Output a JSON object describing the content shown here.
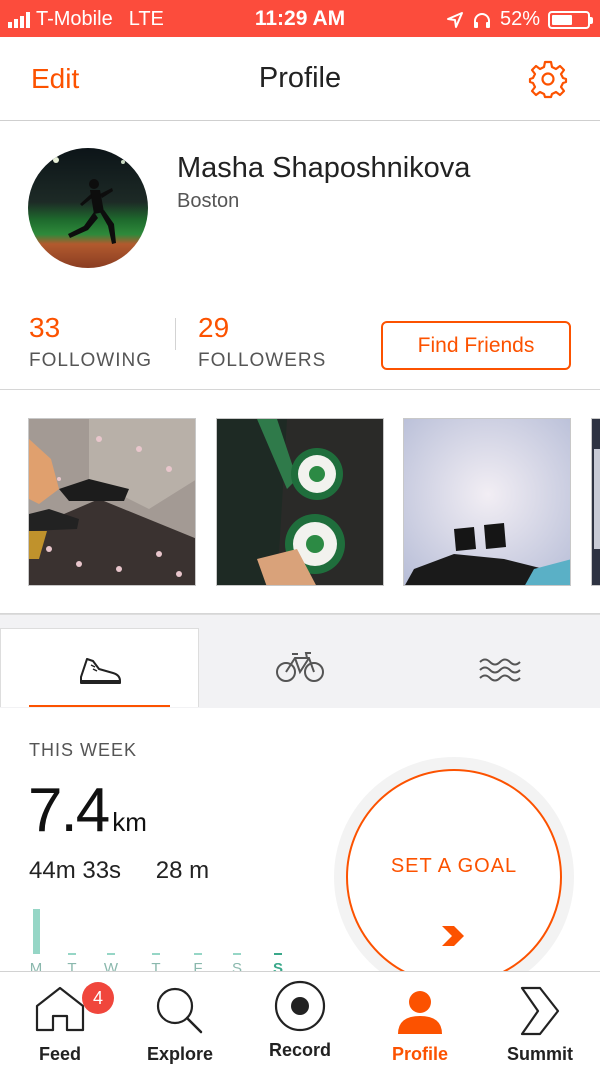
{
  "status_bar": {
    "carrier": "T-Mobile",
    "network": "LTE",
    "time": "11:29 AM",
    "battery": "52%"
  },
  "nav": {
    "edit": "Edit",
    "title": "Profile"
  },
  "profile": {
    "name": "Masha Shaposhnikova",
    "city": "Boston"
  },
  "stats": {
    "following_count": "33",
    "following_label": "FOLLOWING",
    "followers_count": "29",
    "followers_label": "FOLLOWERS",
    "find_friends": "Find Friends"
  },
  "activity": {
    "section_label": "THIS WEEK",
    "distance_value": "7.4",
    "distance_unit": "km",
    "time": "44m 33s",
    "elevation": "28 m",
    "goal_label": "SET A GOAL",
    "day_labels": [
      "M",
      "T",
      "W",
      "T",
      "F",
      "S",
      "S"
    ]
  },
  "tab_bar": {
    "feed": "Feed",
    "feed_badge": "4",
    "explore": "Explore",
    "record": "Record",
    "profile": "Profile",
    "summit": "Summit"
  },
  "colors": {
    "accent": "#fc5200",
    "status_bar": "#fc4c3c"
  }
}
